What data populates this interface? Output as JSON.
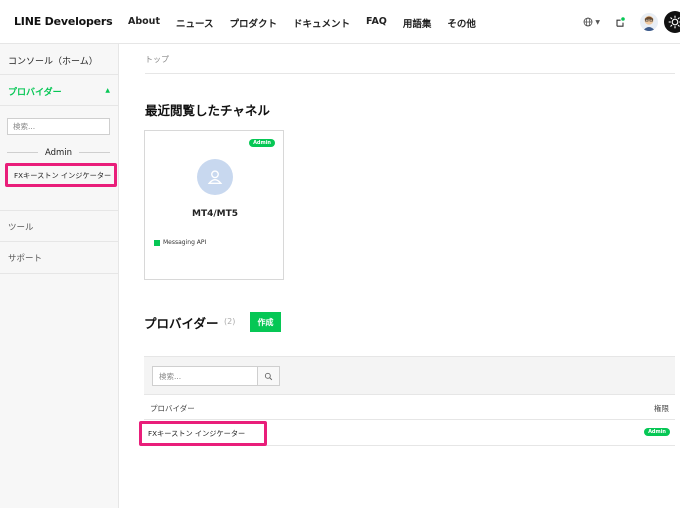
{
  "header": {
    "logo": "LINE Developers",
    "nav": [
      "About",
      "ニュース",
      "プロダクト",
      "ドキュメント",
      "FAQ",
      "用語集",
      "その他"
    ]
  },
  "sidebar": {
    "console": "コンソール（ホーム）",
    "provider": "プロバイダー",
    "search_placeholder": "検索...",
    "admin_label": "Admin",
    "provider_item": "FXキーストン インジケーター",
    "tools": "ツール",
    "support": "サポート"
  },
  "main": {
    "breadcrumb": "トップ",
    "recent_title": "最近閲覧したチャネル",
    "channel_card": {
      "badge": "Admin",
      "name": "MT4/MT5",
      "type": "Messaging API"
    },
    "provider_title": "プロバイダー",
    "provider_count": "(2)",
    "create_button": "作成",
    "table": {
      "search_placeholder": "検索...",
      "col_name": "プロバイダー",
      "col_role": "権限",
      "rows": [
        {
          "name": "FXキーストン インジケーター",
          "role": "Admin"
        }
      ]
    }
  },
  "colors": {
    "accent": "#06c755",
    "highlight": "#e91e7a"
  }
}
